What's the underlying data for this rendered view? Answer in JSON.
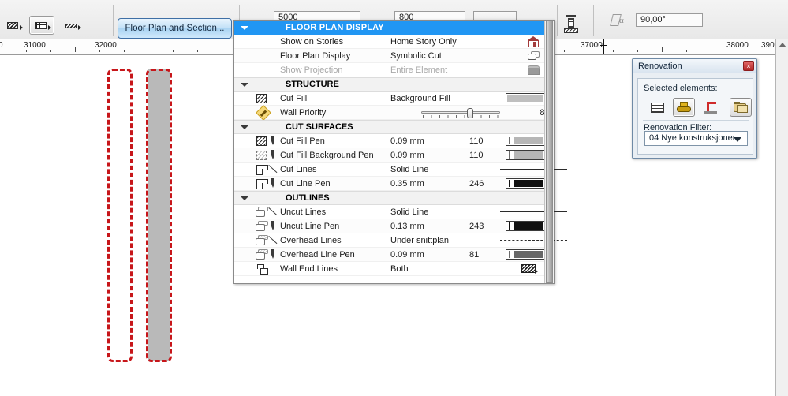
{
  "toolbar": {
    "wall_method_icons": [
      "wall-hatch-left-icon",
      "wall-brick-center-icon",
      "wall-hatch-right-icon"
    ],
    "fps_button": "Floor Plan and Section...",
    "partial_fields": [
      {
        "name": "field-thickness",
        "value": "5000"
      },
      {
        "name": "field-offset",
        "value": "800"
      }
    ],
    "column_icon": "column-structure-icon",
    "angle_icon": "angle-alpha-icon",
    "angle_value": "90,00°"
  },
  "ruler": {
    "labels": [
      "31000",
      "32000",
      "37000",
      "38000",
      "3900"
    ],
    "unit": "mm"
  },
  "panel": {
    "header": {
      "title": "FLOOR PLAN DISPLAY",
      "color": "#2196f3"
    },
    "rows": [
      {
        "icon": "home-story-icon",
        "name": "Show on Stories",
        "value": "Home Story Only",
        "num": "",
        "swatch": "story-house-icon",
        "dim": false
      },
      {
        "icon": "floor-plan-display-icon",
        "name": "Floor Plan Display",
        "value": "Symbolic Cut",
        "num": "",
        "swatch": "symbolic-cut-icon",
        "dim": false
      },
      {
        "icon": "projection-icon",
        "name": "Show Projection",
        "value": "Entire Element",
        "num": "",
        "swatch": "entire-element-icon",
        "dim": true
      }
    ],
    "structure": {
      "title": "STRUCTURE",
      "rows": [
        {
          "icon": "cut-fill-hatch-icon",
          "name": "Cut Fill",
          "value": "Background Fill",
          "num": "",
          "swatch": "fill-swatch",
          "dim": false
        },
        {
          "icon": "wall-priority-icon",
          "name": "Wall Priority",
          "value": "",
          "num": "8",
          "swatch": "priority-slider",
          "dim": false
        }
      ]
    },
    "cut_surfaces": {
      "title": "CUT SURFACES",
      "rows": [
        {
          "icon": "cut-fill-pen-icon",
          "name": "Cut Fill Pen",
          "value": "0.09 mm",
          "num": "110",
          "swatch": "pen-swatch-light",
          "dim": false
        },
        {
          "icon": "cut-fill-background-pen-icon",
          "name": "Cut Fill Background Pen",
          "value": "0.09 mm",
          "num": "110",
          "swatch": "pen-swatch-light",
          "dim": false
        },
        {
          "icon": "cut-lines-icon",
          "name": "Cut Lines",
          "value": "Solid Line",
          "num": "",
          "swatch": "line-preview-solid",
          "dim": false
        },
        {
          "icon": "cut-line-pen-icon",
          "name": "Cut Line Pen",
          "value": "0.35 mm",
          "num": "246",
          "swatch": "pen-swatch-black",
          "dim": false
        }
      ]
    },
    "outlines": {
      "title": "OUTLINES",
      "rows": [
        {
          "icon": "uncut-lines-icon",
          "name": "Uncut Lines",
          "value": "Solid Line",
          "num": "",
          "swatch": "line-preview-solid",
          "dim": false
        },
        {
          "icon": "uncut-line-pen-icon",
          "name": "Uncut Line Pen",
          "value": "0.13 mm",
          "num": "243",
          "swatch": "pen-swatch-black",
          "dim": false
        },
        {
          "icon": "overhead-lines-icon",
          "name": "Overhead Lines",
          "value": "Under snittplan",
          "num": "",
          "swatch": "line-preview-dashed",
          "dim": false
        },
        {
          "icon": "overhead-line-pen-icon",
          "name": "Overhead Line Pen",
          "value": "0.09 mm",
          "num": "81",
          "swatch": "pen-swatch-gray",
          "dim": false
        },
        {
          "icon": "wall-end-lines-icon",
          "name": "Wall End Lines",
          "value": "Both",
          "num": "",
          "swatch": "wall-end-hatch-icon",
          "dim": false
        }
      ]
    }
  },
  "renovation": {
    "title": "Renovation",
    "close_label": "×",
    "selected_elements_label": "Selected elements:",
    "status_buttons": [
      {
        "name": "existing-element-button",
        "icon": "brick-wall-icon",
        "selected": false
      },
      {
        "name": "to-be-demolished-button",
        "icon": "bulldozer-icon",
        "selected": true
      },
      {
        "name": "new-element-button",
        "icon": "crane-icon",
        "selected": false
      }
    ],
    "options_button": {
      "name": "renovation-options-button",
      "icon": "folder-icon"
    },
    "filter_label": "Renovation Filter:",
    "filter_value": "04 Nye konstruksjoner"
  },
  "canvas": {
    "selection_marquee": {
      "name": "marquee-selection",
      "color": "#c7161a"
    },
    "wall_element": {
      "name": "wall-element",
      "fill": "#b9b9b9",
      "color": "#c7161a"
    }
  }
}
